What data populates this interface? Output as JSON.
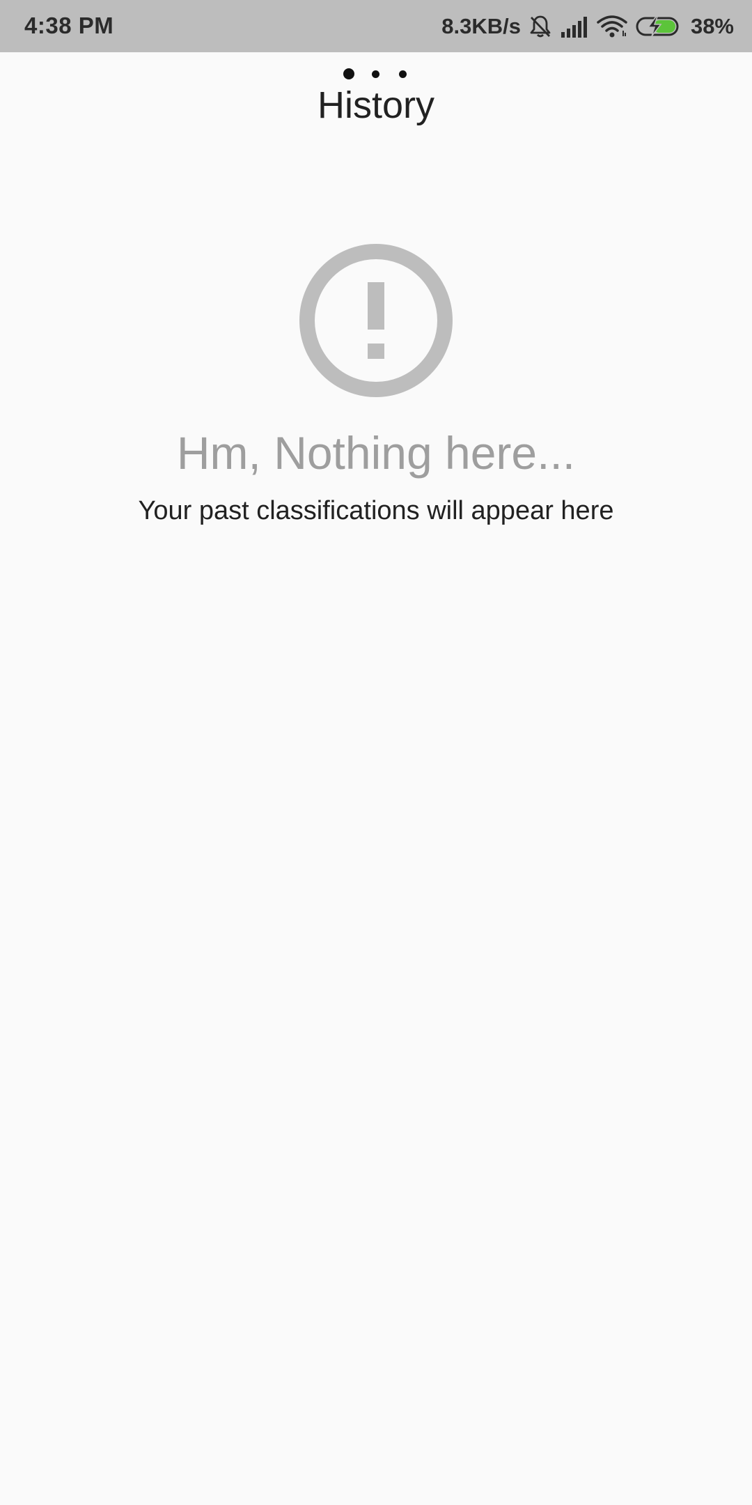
{
  "status_bar": {
    "time": "4:38 PM",
    "network_speed": "8.3KB/s",
    "battery_percent": "38%",
    "icons": [
      "bell-muted-icon",
      "signal-icon",
      "wifi-icon",
      "battery-charging-icon"
    ],
    "battery_level": 0.38,
    "battery_color": "#5cc43a"
  },
  "pager": {
    "page_count": 3,
    "active_index": 0
  },
  "header": {
    "title": "History"
  },
  "empty_state": {
    "icon": "alert-circle-icon",
    "icon_color": "#bdbdbd",
    "title": "Hm, Nothing here...",
    "subtitle": "Your past classifications will appear here"
  },
  "colors": {
    "background": "#fafafa",
    "status_bar": "#bdbdbd"
  }
}
